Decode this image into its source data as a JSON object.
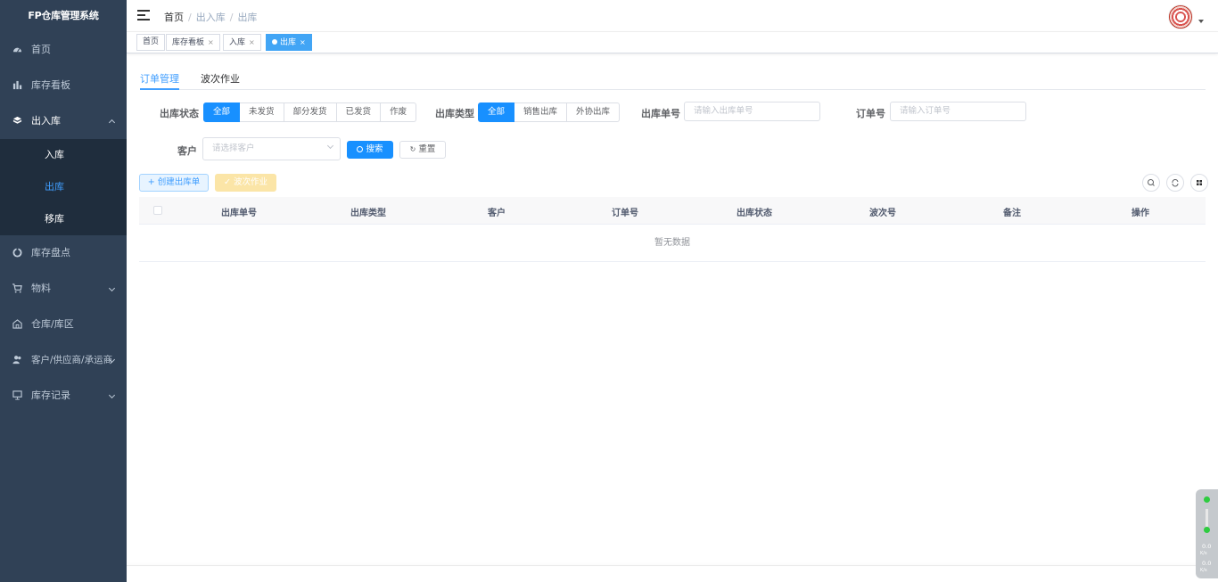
{
  "app": {
    "title": "FP仓库管理系统"
  },
  "sidebar": {
    "items": [
      {
        "label": "首页",
        "icon": "dashboard-icon"
      },
      {
        "label": "库存看板",
        "icon": "bar-chart-icon"
      },
      {
        "label": "出入库",
        "icon": "box-icon",
        "expanded": true,
        "children": [
          {
            "label": "入库"
          },
          {
            "label": "出库",
            "active": true
          },
          {
            "label": "移库"
          }
        ]
      },
      {
        "label": "库存盘点",
        "icon": "cycle-icon"
      },
      {
        "label": "物料",
        "icon": "cart-icon"
      },
      {
        "label": "仓库/库区",
        "icon": "warehouse-icon"
      },
      {
        "label": "客户/供应商/承运商",
        "icon": "users-icon"
      },
      {
        "label": "库存记录",
        "icon": "monitor-icon"
      }
    ]
  },
  "header": {
    "breadcrumb": [
      "首页",
      "出入库",
      "出库"
    ],
    "separator": "/"
  },
  "tags_view": {
    "tags": [
      {
        "label": "首页"
      },
      {
        "label": "库存看板",
        "closable": true
      },
      {
        "label": "入库",
        "closable": true
      },
      {
        "label": "出库",
        "closable": true,
        "active": true
      }
    ],
    "close_glyph": "×"
  },
  "tabs": [
    {
      "label": "订单管理",
      "active": true
    },
    {
      "label": "波次作业"
    }
  ],
  "filters": {
    "status_label": "出库状态",
    "status_options": [
      "全部",
      "未发货",
      "部分发货",
      "已发货",
      "作废"
    ],
    "status_selected": "全部",
    "type_label": "出库类型",
    "type_options": [
      "全部",
      "销售出库",
      "外协出库"
    ],
    "type_selected": "全部",
    "outbound_no_label": "出库单号",
    "outbound_no_placeholder": "请输入出库单号",
    "order_no_label": "订单号",
    "order_no_placeholder": "请输入订单号",
    "customer_label": "客户",
    "customer_placeholder": "请选择客户",
    "search_label": "搜索",
    "reset_label": "重置"
  },
  "toolbar": {
    "create_label": "创建出库单",
    "wave_label": "波次作业"
  },
  "table": {
    "columns": [
      "出库单号",
      "出库类型",
      "客户",
      "订单号",
      "出库状态",
      "波次号",
      "备注",
      "操作"
    ],
    "rows": [],
    "empty_text": "暂无数据"
  },
  "net_widget": {
    "upload": "0.0",
    "upload_unit": "K/s",
    "download": "0.0",
    "download_unit": "K/s"
  },
  "colors": {
    "sidebar_bg": "#304156",
    "submenu_bg": "#1f2d3d",
    "primary": "#1890ff",
    "warning_light": "#fbe5a7"
  }
}
